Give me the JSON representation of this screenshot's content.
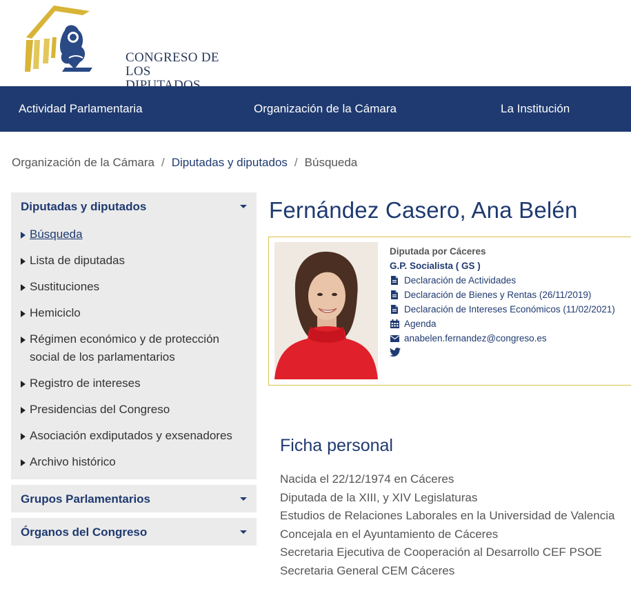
{
  "header": {
    "logo_line1": "CONGRESO DE",
    "logo_line2": "LOS DIPUTADOS",
    "brand_gold": "#d8b437",
    "brand_blue": "#1f3a70"
  },
  "nav": {
    "items": [
      "Actividad Parlamentaria",
      "Organización de la Cámara",
      "La Institución"
    ]
  },
  "breadcrumb": {
    "items": [
      "Organización de la Cámara",
      "Diputadas y diputados",
      "Búsqueda"
    ],
    "separator": "/"
  },
  "sidebar": {
    "panels": [
      {
        "title": "Diputadas y diputados",
        "items": [
          "Búsqueda",
          "Lista de diputadas",
          "Sustituciones",
          "Hemiciclo",
          "Régimen económico y de protección social de los parlamentarios",
          "Registro de intereses",
          "Presidencias del Congreso",
          "Asociación exdiputados y exsenadores",
          "Archivo histórico"
        ],
        "active_item": "Búsqueda"
      },
      {
        "title": "Grupos Parlamentarios"
      },
      {
        "title": "Órganos del Congreso"
      }
    ]
  },
  "profile": {
    "name": "Fernández Casero, Ana Belén",
    "role": "Diputada por Cáceres",
    "group": "G.P. Socialista ( GS )",
    "links": [
      {
        "icon": "document-icon",
        "label": "Declaración de Actividades"
      },
      {
        "icon": "document-icon",
        "label": "Declaración de Bienes y Rentas (26/11/2019)"
      },
      {
        "icon": "document-icon",
        "label": "Declaración de Intereses Económicos (11/02/2021)"
      },
      {
        "icon": "calendar-icon",
        "label": "Agenda"
      },
      {
        "icon": "envelope-icon",
        "label": "anabelen.fernandez@congreso.es"
      }
    ],
    "social_icon": "twitter-icon"
  },
  "ficha": {
    "title": "Ficha personal",
    "lines": [
      "Nacida el 22/12/1974 en Cáceres",
      "Diputada de la XIII, y XIV Legislaturas",
      "Estudios de Relaciones Laborales en la Universidad de Valencia",
      "Concejala en el Ayuntamiento de Cáceres",
      "Secretaria Ejecutiva de Cooperación al Desarrollo CEF PSOE",
      "Secretaria General CEM Cáceres"
    ]
  }
}
